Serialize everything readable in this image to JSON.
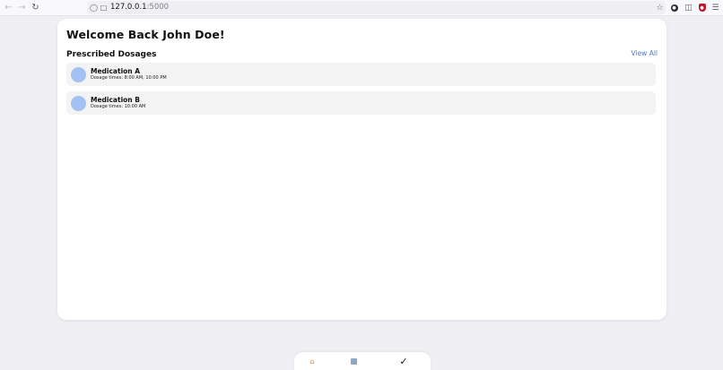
{
  "browser": {
    "url_host": "127.0.0.1",
    "url_port": ":5000",
    "icons": {
      "back": "arrow-left-icon",
      "forward": "arrow-right-icon",
      "reload": "reload-icon",
      "shield": "shield-icon",
      "page": "page-icon",
      "bookmark": "star-icon",
      "menu": "hamburger-icon"
    }
  },
  "page": {
    "welcome": "Welcome Back John Doe!",
    "section_title": "Prescribed Dosages",
    "view_all": "View All",
    "medications": [
      {
        "name": "Medication A",
        "times": "Dosage times: 8:00 AM, 10:00 PM"
      },
      {
        "name": "Medication B",
        "times": "Dosage times: 10:00 AM"
      }
    ]
  },
  "colors": {
    "accent": "#4a7bd6",
    "avatar": "#a4c1f4",
    "background": "#f0f0f4",
    "card": "#ffffff",
    "item": "#f3f3f3"
  }
}
